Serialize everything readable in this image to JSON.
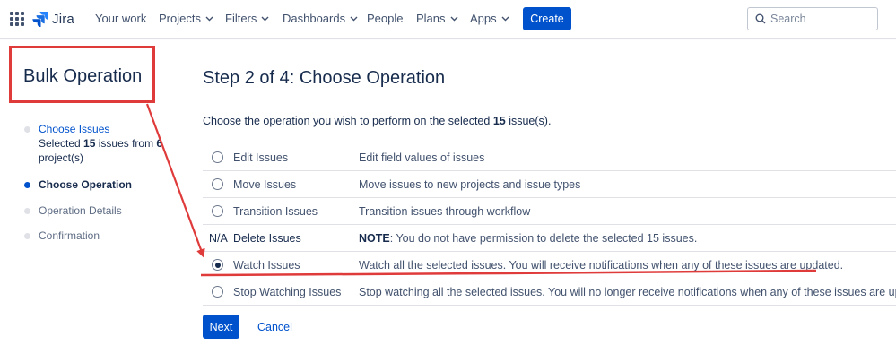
{
  "nav": {
    "logo_text": "Jira",
    "items": [
      {
        "label": "Your work",
        "dropdown": false
      },
      {
        "label": "Projects",
        "dropdown": true
      },
      {
        "label": "Filters",
        "dropdown": true
      },
      {
        "label": "Dashboards",
        "dropdown": true
      },
      {
        "label": "People",
        "dropdown": false
      },
      {
        "label": "Plans",
        "dropdown": true
      },
      {
        "label": "Apps",
        "dropdown": true
      }
    ],
    "create_label": "Create",
    "search_placeholder": "Search"
  },
  "sidebar": {
    "title": "Bulk Operation",
    "steps": [
      {
        "label": "Choose Issues",
        "detail_pre": "Selected ",
        "detail_count": "15",
        "detail_mid": " issues from ",
        "detail_projects": "6",
        "detail_post": " project(s)"
      },
      {
        "label": "Choose Operation"
      },
      {
        "label": "Operation Details"
      },
      {
        "label": "Confirmation"
      }
    ]
  },
  "main": {
    "title": "Step 2 of 4: Choose Operation",
    "intro_pre": "Choose the operation you wish to perform on the selected ",
    "intro_count": "15",
    "intro_post": " issue(s).",
    "operations": [
      {
        "label": "Edit Issues",
        "description": "Edit field values of issues",
        "checked": false
      },
      {
        "label": "Move Issues",
        "description": "Move issues to new projects and issue types",
        "checked": false
      },
      {
        "label": "Transition Issues",
        "description": "Transition issues through workflow",
        "checked": false
      },
      {
        "na_label": "N/A",
        "label": "Delete Issues",
        "note_label": "NOTE",
        "description": ": You do not have permission to delete the selected 15 issues."
      },
      {
        "label": "Watch Issues",
        "description": "Watch all the selected issues. You will receive notifications when any of these issues are updated.",
        "checked": true
      },
      {
        "label": "Stop Watching Issues",
        "description": "Stop watching all the selected issues. You will no longer receive notifications when any of these issues are updated.",
        "checked": false
      }
    ],
    "next_label": "Next",
    "cancel_label": "Cancel"
  },
  "colors": {
    "brand": "#0052cc",
    "annotation": "#e03b3b",
    "text": "#172b4d"
  }
}
